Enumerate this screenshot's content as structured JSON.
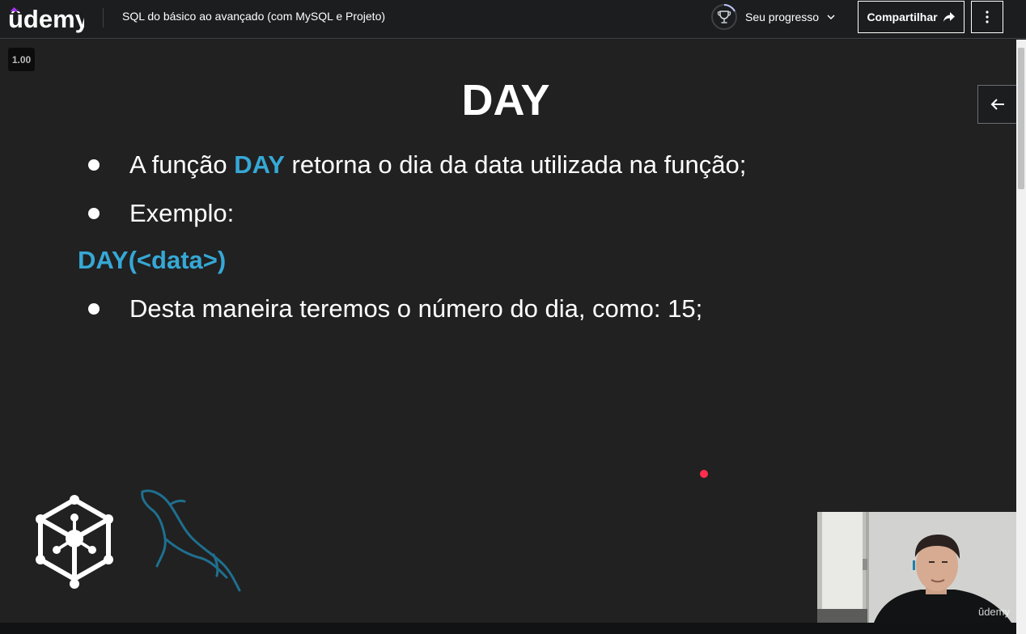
{
  "header": {
    "brand": "ûdemy",
    "course_title": "SQL do básico ao avançado (com MySQL e Projeto)",
    "progress_label": "Seu progresso",
    "share_label": "Compartilhar",
    "icons": {
      "progress": "trophy-icon",
      "chevron": "chevron-down-icon",
      "share": "share-arrow-icon",
      "more": "kebab-menu-icon"
    }
  },
  "player": {
    "speed": "1.00",
    "side_toggle_icon": "arrow-left-icon",
    "watermark": "ûdemy"
  },
  "slide": {
    "title": "DAY",
    "bullet1": {
      "before": "A função ",
      "highlight": "DAY",
      "after": " retorna o dia da data utilizada na função;"
    },
    "bullet2": "Exemplo:",
    "code": "DAY(<data>)",
    "bullet3": "Desta maneira teremos o número do dia, como: 15;",
    "logos": [
      "data-cube-logo",
      "mysql-dolphin-logo"
    ]
  },
  "colors": {
    "accent": "#36a8d6",
    "udemy_purple": "#a435f0",
    "laser": "#ff2e4d",
    "background": "#1c1d1f"
  }
}
